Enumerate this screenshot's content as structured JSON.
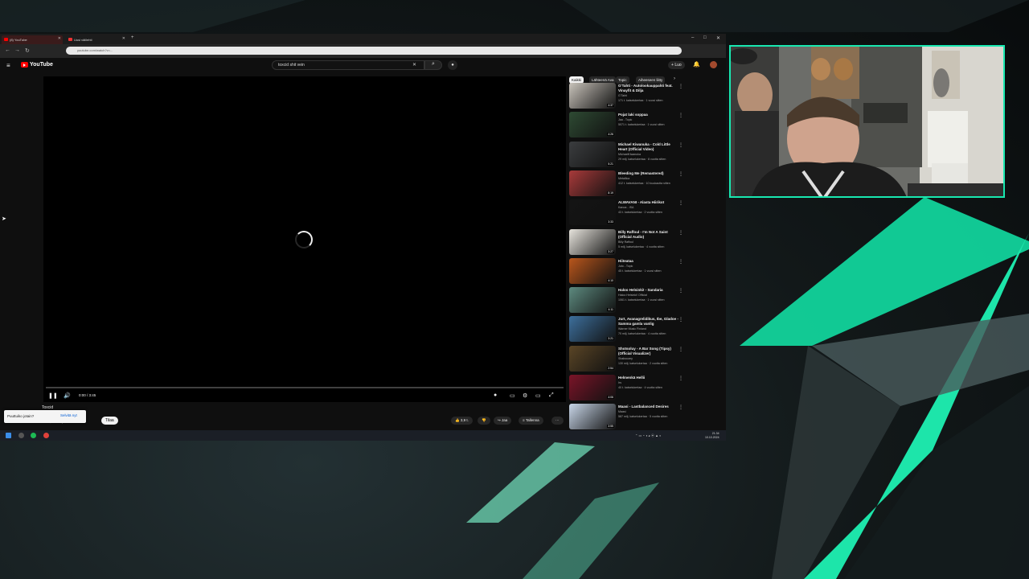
{
  "browser": {
    "tabs": [
      {
        "label": "(8) YouTube",
        "active": true
      },
      {
        "label": "Uusi välilehti",
        "active": false
      }
    ],
    "url": "youtube.com/watch?v=...",
    "new_tab_icon": "plus-icon"
  },
  "youtube": {
    "brand": "YouTube",
    "search_query": "toxcid shit vein",
    "create_label": "Luo",
    "colors": {
      "brand_red": "#ff0000",
      "accent": "#18e8b0"
    }
  },
  "player": {
    "time": "0:00 / 3:45",
    "progress_fraction": 0.0,
    "loading": true
  },
  "below": {
    "title": "Toxcid",
    "channel_info": "1,6 t. tilaajaa",
    "subscribe": "Tilaa",
    "likes": "3,9 t.",
    "share": "Jaa",
    "save": "Tallenna",
    "popup_text": "Puuttuiko jotain?",
    "popup_action": "Selvitä nyt"
  },
  "sidebar": {
    "chips": [
      "Kaikki",
      "Lähteenä Ava",
      "Topic",
      "Aiheeseen liitty"
    ],
    "items": [
      {
        "title": "G'Tahti - Autolookauppahti feat. Vinayfit & Dilja",
        "channel": "G'Tahti",
        "meta": "171 t. katselukertaa · 1 vuosi sitten",
        "duration": "4:37",
        "color": "#c9c4bb"
      },
      {
        "title": "Pojat laki soppaa",
        "channel": "Jaa - Topic",
        "meta": "5071 t. katselukertaa · 1 vuosi sitten",
        "duration": "4:26",
        "color": "#2e4a33"
      },
      {
        "title": "Michael Kiwanuka - Cold Little Heart (Official Video)",
        "channel": "MichaelKiwanuka",
        "meta": "29 milj. katselukertaa · 8 vuotta sitten",
        "duration": "5:21",
        "color": "#3b3d3f"
      },
      {
        "title": "Bleeding Me (Remastered)",
        "channel": "Metallica",
        "meta": "412 t. katselukertaa · 10 kuukautta sitten",
        "duration": "8:19",
        "color": "#a83a3a"
      },
      {
        "title": "ALWAVANI - Alasta Hiirikot",
        "channel": "Kanoa - ISA",
        "meta": "43 t. katselukertaa · 2 vuotta sitten",
        "duration": "3:33",
        "color": "#141414"
      },
      {
        "title": "Billy Raffoul - I'm Not A Saint (Official Audio)",
        "channel": "Billy Raffoul",
        "meta": "5 milj. katselukertaa · 4 vuotta sitten",
        "duration": "3:27",
        "color": "#e7e4dd"
      },
      {
        "title": "Hiiteataa",
        "channel": "Juto - Topic",
        "meta": "45 t. katselukertaa · 1 vuosi sitten",
        "duration": "4:10",
        "color": "#b9561c"
      },
      {
        "title": "Haloo Helsinki! - Sandaria",
        "channel": "Haloo Helsinki! Official",
        "meta": "1061 t. katselukertaa · 1 vuosi sitten",
        "duration": "4:11",
        "color": "#5d8a7f"
      },
      {
        "title": "Jurt, Avanagrelidikus, Ibe, Gladoe - Samma gamla vanlig",
        "channel": "Warner Music Finland",
        "meta": "70 milj. katselukertaa · 4 vuotta sitten",
        "duration": "3:21",
        "color": "#3d6f9c"
      },
      {
        "title": "Shotsoluy - A Bar Song (Tipsy) (Official Visualizer)",
        "channel": "Shaboozey",
        "meta": "130 milj. katselukertaa · 2 vuotta sitten",
        "duration": "2:54",
        "color": "#5a4526"
      },
      {
        "title": "Helmenkä Hellii",
        "channel": "Irs",
        "meta": "40 t. katselukertaa · 4 vuotta sitten",
        "duration": "4:06",
        "color": "#7a1428"
      },
      {
        "title": "Maasi - Lastbalanced Desires",
        "channel": "Maasi",
        "meta": "587 milj. katselukertaa · 5 vuotta sitten",
        "duration": "3:55",
        "color": "#c8d6e8"
      }
    ]
  },
  "taskbar": {
    "time": "21.34",
    "date": "10.10.2024"
  }
}
